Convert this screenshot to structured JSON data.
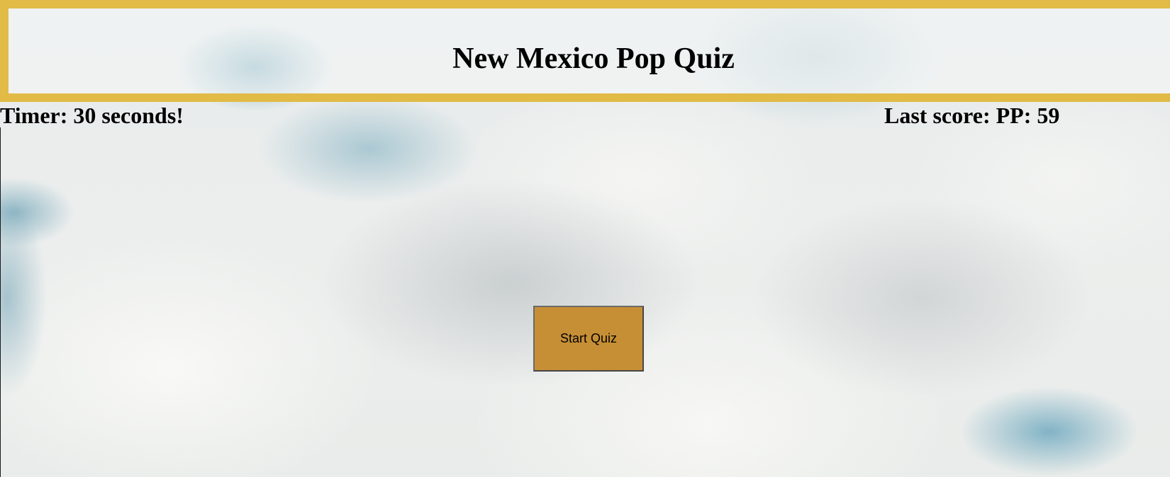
{
  "header": {
    "title": "New Mexico Pop Quiz",
    "border_color": "#e1bb46"
  },
  "status": {
    "timer_text": "Timer: 30 seconds!",
    "last_score_text": "Last score: PP: 59"
  },
  "main": {
    "start_button_label": "Start Quiz",
    "start_button_color": "#c78f35"
  },
  "background": {
    "image_description_icon": "cloudy-sky-background"
  }
}
